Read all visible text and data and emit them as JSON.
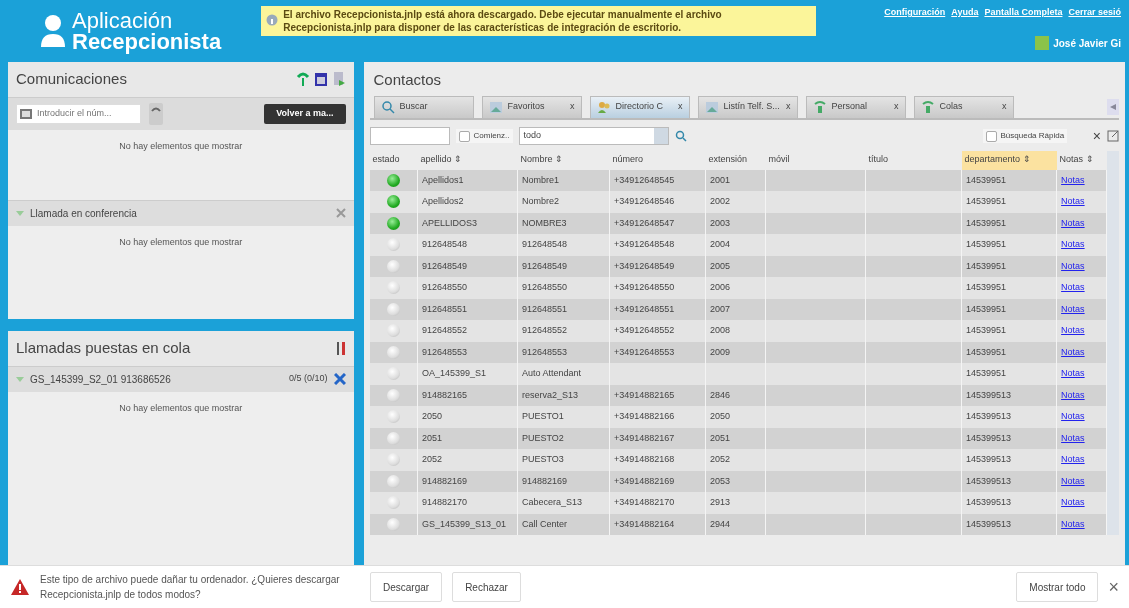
{
  "header": {
    "app_name_line1": "Aplicación",
    "app_name_line2": "Recepcionista",
    "notice": "El archivo Recepcionista.jnlp está ahora descargado. Debe ejecutar manualmente el archivo Recepcionista.jnlp para disponer de las características de integración de escritorio.",
    "links": [
      "Configuración",
      "Ayuda",
      "Pantalla Completa",
      "Cerrar sesió"
    ],
    "user": "José Javier Gi"
  },
  "communications": {
    "title": "Comunicaciones",
    "dial_placeholder": "Introducir el núm...",
    "return_button": "Volver a ma...",
    "empty": "No hay elementos que mostrar",
    "conference": {
      "title": "Llamada en conferencia",
      "expanded": true,
      "empty": "No hay elementos que mostrar"
    }
  },
  "queued_calls": {
    "title": "Llamadas puestas en cola",
    "queues": [
      {
        "name": "GS_145399_S2_01 913686526",
        "count": "0/5 (0/10)",
        "expanded": true,
        "empty": "No hay elementos que mostrar"
      }
    ]
  },
  "contacts": {
    "title": "Contactos",
    "tabs": [
      {
        "label": "Buscar",
        "kind": "search",
        "selected": false
      },
      {
        "label": "Favoritos",
        "kind": "directory",
        "close": "x",
        "selected": false
      },
      {
        "label": "Directorio C",
        "kind": "people",
        "close": "x",
        "selected": true
      },
      {
        "label": "Listín Telf. S...",
        "kind": "directory",
        "close": "x",
        "selected": false
      },
      {
        "label": "Personal",
        "kind": "phone",
        "close": "x",
        "selected": false
      },
      {
        "label": "Colas",
        "kind": "phone",
        "close": "x",
        "selected": false
      }
    ],
    "filter": {
      "starts_with": {
        "label": "Comienz..",
        "checked": false
      },
      "scope": "todo",
      "quick_search": {
        "label": "Búsqueda Rápida",
        "checked": false
      },
      "close": "×"
    },
    "columns": [
      {
        "label": "estado"
      },
      {
        "label": "apellido",
        "sort": "⇕"
      },
      {
        "label": "Nombre",
        "sort": "⇕"
      },
      {
        "label": "número"
      },
      {
        "label": "extensión"
      },
      {
        "label": "móvil"
      },
      {
        "label": "título"
      },
      {
        "label": "departamento",
        "sort": "⇕",
        "sorted": true
      },
      {
        "label": "Notas",
        "sort": "⇕"
      }
    ],
    "rows": [
      {
        "online": true,
        "cells": [
          "",
          "Apellidos1",
          "Nombre1",
          "+34912648545",
          "2001",
          "",
          "",
          "14539951",
          "Notas"
        ]
      },
      {
        "online": true,
        "cells": [
          "",
          "Apellidos2",
          "Nombre2",
          "+34912648546",
          "2002",
          "",
          "",
          "14539951",
          "Notas"
        ]
      },
      {
        "online": true,
        "cells": [
          "",
          "APELLIDOS3",
          "NOMBRE3",
          "+34912648547",
          "2003",
          "",
          "",
          "14539951",
          "Notas"
        ]
      },
      {
        "online": false,
        "cells": [
          "",
          "912648548",
          "912648548",
          "+34912648548",
          "2004",
          "",
          "",
          "14539951",
          "Notas"
        ]
      },
      {
        "online": false,
        "cells": [
          "",
          "912648549",
          "912648549",
          "+34912648549",
          "2005",
          "",
          "",
          "14539951",
          "Notas"
        ]
      },
      {
        "online": false,
        "cells": [
          "",
          "912648550",
          "912648550",
          "+34912648550",
          "2006",
          "",
          "",
          "14539951",
          "Notas"
        ]
      },
      {
        "online": false,
        "cells": [
          "",
          "912648551",
          "912648551",
          "+34912648551",
          "2007",
          "",
          "",
          "14539951",
          "Notas"
        ]
      },
      {
        "online": false,
        "cells": [
          "",
          "912648552",
          "912648552",
          "+34912648552",
          "2008",
          "",
          "",
          "14539951",
          "Notas"
        ]
      },
      {
        "online": false,
        "cells": [
          "",
          "912648553",
          "912648553",
          "+34912648553",
          "2009",
          "",
          "",
          "14539951",
          "Notas"
        ]
      },
      {
        "online": false,
        "cells": [
          "",
          "OA_145399_S1",
          "Auto Attendant",
          "",
          "",
          "",
          "",
          "14539951",
          "Notas"
        ]
      },
      {
        "online": false,
        "cells": [
          "",
          "914882165",
          "reserva2_S13",
          "+34914882165",
          "2846",
          "",
          "",
          "145399513",
          "Notas"
        ]
      },
      {
        "online": false,
        "cells": [
          "",
          "2050",
          "PUESTO1",
          "+34914882166",
          "2050",
          "",
          "",
          "145399513",
          "Notas"
        ]
      },
      {
        "online": false,
        "cells": [
          "",
          "2051",
          "PUESTO2",
          "+34914882167",
          "2051",
          "",
          "",
          "145399513",
          "Notas"
        ]
      },
      {
        "online": false,
        "cells": [
          "",
          "2052",
          "PUESTO3",
          "+34914882168",
          "2052",
          "",
          "",
          "145399513",
          "Notas"
        ]
      },
      {
        "online": false,
        "cells": [
          "",
          "914882169",
          "914882169",
          "+34914882169",
          "2053",
          "",
          "",
          "145399513",
          "Notas"
        ]
      },
      {
        "online": false,
        "cells": [
          "",
          "914882170",
          "Cabecera_S13",
          "+34914882170",
          "2913",
          "",
          "",
          "145399513",
          "Notas"
        ]
      },
      {
        "online": false,
        "cells": [
          "",
          "GS_145399_S13_01",
          "Call Center",
          "+34914882164",
          "2944",
          "",
          "",
          "145399513",
          "Notas"
        ]
      }
    ]
  },
  "download_bar": {
    "message": "Este tipo de archivo puede dañar tu ordenador. ¿Quieres descargar Recepcionista.jnlp de todos modos?",
    "buttons": [
      "Descargar",
      "Rechazar"
    ],
    "show_all": "Mostrar todo",
    "close": "×"
  }
}
